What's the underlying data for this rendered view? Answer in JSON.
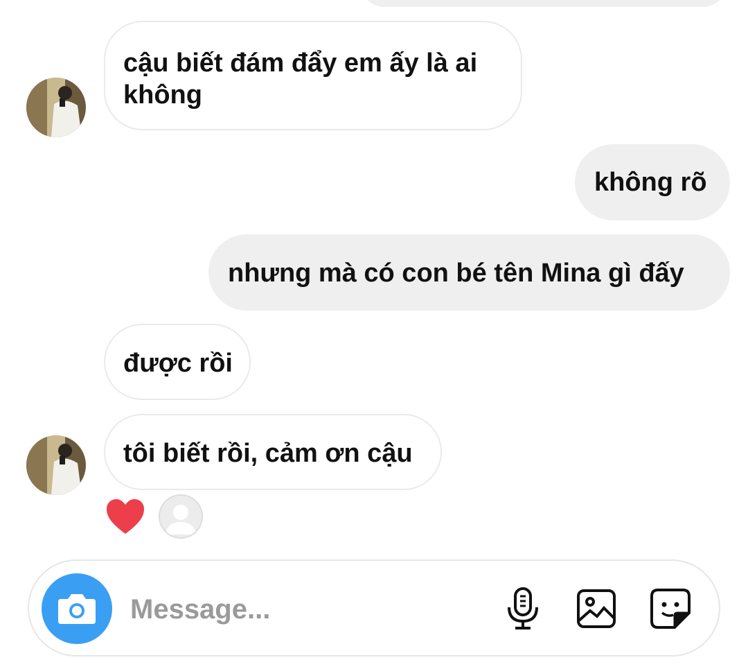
{
  "messages": [
    {
      "side": "in",
      "text_line1": "cậu biết đám đẩy em ấy là ai",
      "text_line2": "không"
    },
    {
      "side": "out",
      "text": "không rõ"
    },
    {
      "side": "out",
      "text": "nhưng mà có con bé tên Mina gì đấy"
    },
    {
      "side": "in",
      "text": "được rồi"
    },
    {
      "side": "in",
      "text": "tôi biết rồi, cảm ơn cậu"
    }
  ],
  "reactions": {
    "emoji": "heart-icon",
    "color": "#ed3e4b"
  },
  "composer": {
    "placeholder": "Message...",
    "camera_color": "#3a9ff3",
    "icons": [
      "microphone-icon",
      "gallery-icon",
      "sticker-icon"
    ]
  }
}
